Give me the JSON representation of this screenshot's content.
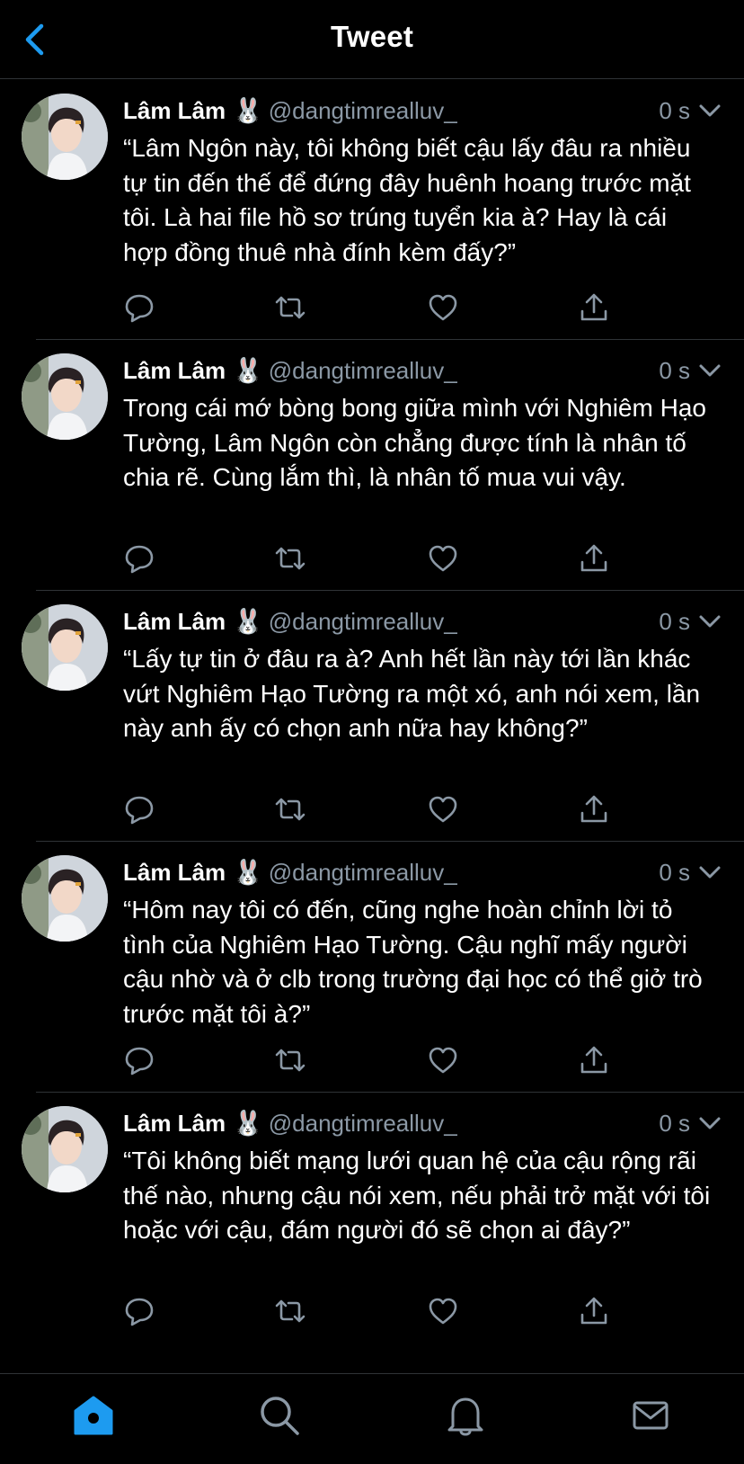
{
  "header": {
    "title": "Tweet",
    "back_icon": "chevron-left-icon",
    "accent_color": "#1d9bf0"
  },
  "tweets": [
    {
      "display_name": "Lâm Lâm",
      "emoji": "🐰",
      "handle": "@dangtimrealluv_",
      "time": "0 s",
      "text": "“Lâm Ngôn này, tôi không biết cậu lấy đâu ra nhiều tự tin đến thế để đứng đây huênh hoang trước mặt tôi. Là hai file hồ sơ trúng tuyển kia à? Hay là cái hợp đồng thuê nhà đính kèm đấy?”"
    },
    {
      "display_name": "Lâm Lâm",
      "emoji": "🐰",
      "handle": "@dangtimrealluv_",
      "time": "0 s",
      "text": "Trong cái mớ bòng bong giữa mình với Nghiêm Hạo Tường, Lâm Ngôn còn chẳng được tính là nhân tố chia rẽ. Cùng lắm thì, là nhân tố mua vui vậy."
    },
    {
      "display_name": "Lâm Lâm",
      "emoji": "🐰",
      "handle": "@dangtimrealluv_",
      "time": "0 s",
      "text": "“Lấy tự tin ở đâu ra à? Anh hết lần này tới lần khác vứt Nghiêm Hạo Tường ra một xó, anh nói xem, lần này anh ấy có chọn anh nữa hay không?”"
    },
    {
      "display_name": "Lâm Lâm",
      "emoji": "🐰",
      "handle": "@dangtimrealluv_",
      "time": "0 s",
      "text": "“Hôm nay tôi có đến, cũng nghe hoàn chỉnh lời tỏ tình của Nghiêm Hạo Tường. Cậu nghĩ mấy người cậu nhờ và ở clb trong trường đại học có thể giở trò trước mặt tôi à?”"
    },
    {
      "display_name": "Lâm Lâm",
      "emoji": "🐰",
      "handle": "@dangtimrealluv_",
      "time": "0 s",
      "text": "“Tôi không biết mạng lưới quan hệ của cậu rộng rãi thế nào, nhưng cậu nói xem, nếu phải trở mặt với tôi hoặc với cậu, đám người đó sẽ chọn ai đây?”"
    }
  ],
  "tweet_actions": [
    "reply-icon",
    "retweet-icon",
    "like-icon",
    "share-icon"
  ],
  "bottom_nav": [
    "home-icon",
    "search-icon",
    "notifications-icon",
    "messages-icon"
  ]
}
